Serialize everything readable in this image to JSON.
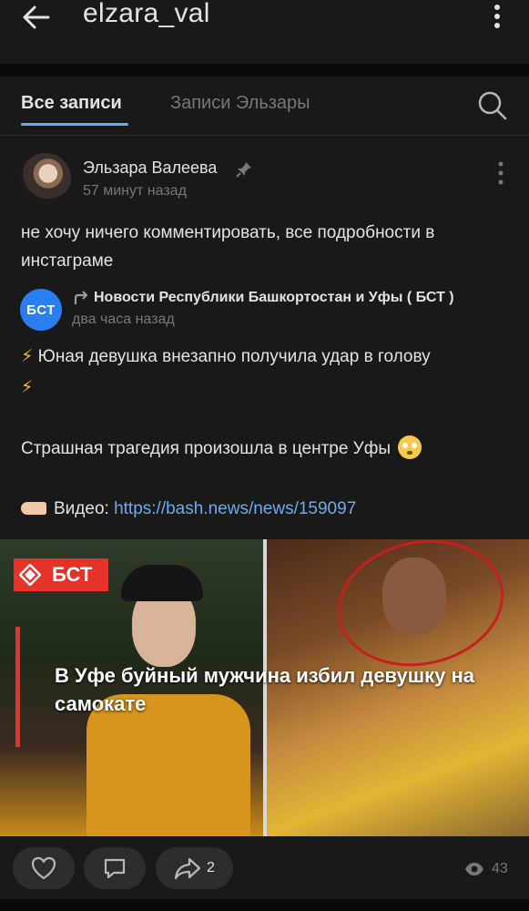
{
  "header": {
    "title": "elzara_val",
    "back_icon": "arrow-left-icon",
    "menu_icon": "kebab-icon"
  },
  "tabs": [
    {
      "label": "Все записи",
      "active": true
    },
    {
      "label": "Записи Эльзары",
      "active": false
    }
  ],
  "post": {
    "author": "Эльзара Валеева",
    "time": "57 минут назад",
    "text": "не хочу ничего комментировать, все подробности в инстаграме",
    "repost": {
      "avatar_text": "БСТ",
      "source": "Новости Республики Башкортостан и Уфы ( БСТ )",
      "time": "два часа назад",
      "lines": {
        "l1": "Юная девушка внезапно получила удар в голову",
        "l2": "Страшная трагедия произошла в центре Уфы",
        "video_label": "Видео:",
        "link": "https://bash.news/news/159097"
      },
      "media": {
        "brand": "БСТ",
        "headline": "В Уфе буйный мужчина избил девушку на самокате"
      }
    }
  },
  "actions": {
    "likes": "",
    "comments": "",
    "shares": "2",
    "views": "43"
  },
  "colors": {
    "accent": "#71aaeb",
    "background": "#19191a",
    "muted": "#76787a",
    "brand_red": "#e6332a"
  }
}
